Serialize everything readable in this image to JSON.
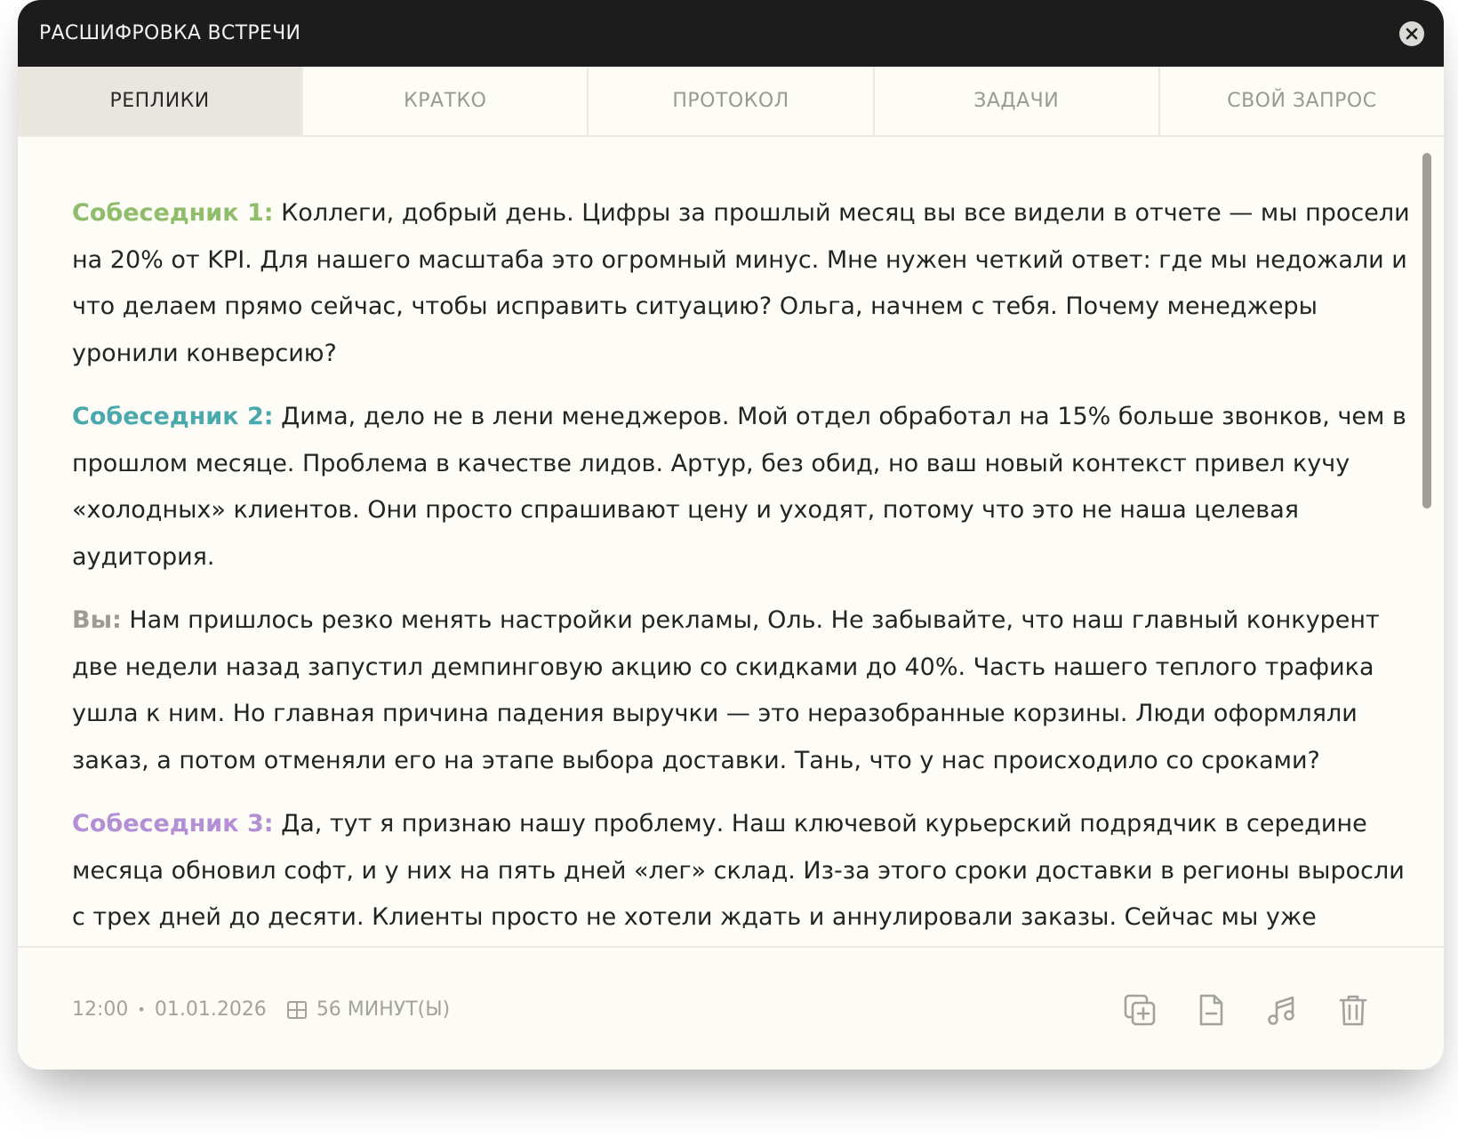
{
  "window": {
    "title": "РАСШИФРОВКА ВСТРЕЧИ"
  },
  "tabs": [
    {
      "label": "РЕПЛИКИ",
      "active": true
    },
    {
      "label": "КРАТКО",
      "active": false
    },
    {
      "label": "ПРОТОКОЛ",
      "active": false
    },
    {
      "label": "ЗАДАЧИ",
      "active": false
    },
    {
      "label": "СВОЙ ЗАПРОС",
      "active": false
    }
  ],
  "transcript": [
    {
      "speaker": "Собеседник 1:",
      "color": "#8fbd6a",
      "text": " Коллеги, добрый день. Цифры за прошлый месяц вы все видели в отчете — мы просели на 20% от KPI. Для нашего масштаба это огромный минус. Мне нужен четкий ответ: где мы недожали и что делаем прямо сейчас, чтобы исправить ситуацию? Ольга, начнем с тебя. Почему менеджеры уронили конверсию?"
    },
    {
      "speaker": "Собеседник 2:",
      "color": "#4aa9ad",
      "text": " Дима, дело не в лени менеджеров. Мой отдел обработал на 15% больше звонков, чем в прошлом месяце. Проблема в качестве лидов. Артур, без обид, но ваш новый контекст привел кучу «холодных» клиентов. Они просто спрашивают цену и уходят, потому что это не наша целевая аудитория."
    },
    {
      "speaker": "Вы:",
      "color": "#9d9b94",
      "text": " Нам пришлось резко менять настройки рекламы, Оль. Не забывайте, что наш главный конкурент две недели назад запустил демпинговую акцию со скидками до 40%. Часть нашего теплого трафика ушла к ним. Но главная причина падения выручки — это неразобранные корзины. Люди оформляли заказ, а потом отменяли его на этапе выбора доставки. Тань, что у нас происходило со сроками?"
    },
    {
      "speaker": "Собеседник 3:",
      "color": "#b38fd6",
      "text": " Да, тут я признаю нашу проблему. Наш ключевой курьерский подрядчик в середине месяца обновил софт, и у них на пять дней «лег» склад. Из-за этого сроки доставки в регионы выросли с трех дней до десяти. Клиенты просто не хотели ждать и аннулировали заказы. Сейчас мы уже"
    }
  ],
  "footer": {
    "time": "12:00",
    "separator": "•",
    "date": "01.01.2026",
    "duration": "56 МИНУТ(Ы)",
    "duration_icon": "table-icon",
    "actions": [
      "copy-add-icon",
      "document-icon",
      "music-icon",
      "trash-icon"
    ]
  },
  "colors": {
    "titlebar": "#1c1c1c",
    "background": "#fdfcf6",
    "active_tab": "#e9e6df",
    "icon": "#a3a29c"
  }
}
